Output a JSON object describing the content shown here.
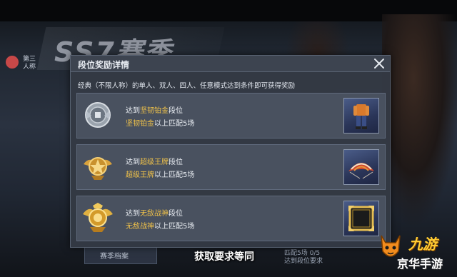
{
  "background": {
    "season_banner": "SS7赛季",
    "left_mode_label": "第三人称"
  },
  "dialog": {
    "title": "段位奖励详情",
    "close_icon": "close-icon",
    "description": "经典（不限人称）的单人、双人、四人、任意模式达到条件即可获得奖励",
    "rows": [
      {
        "line1_prefix": "达到",
        "tier": "坚韧铂金",
        "line1_suffix": "段位",
        "line2_tier": "坚韧铂金",
        "line2_suffix": "以上匹配5场",
        "emblem_icon": "platinum-emblem-icon",
        "reward_icon": "outfit-reward-icon",
        "tier_color": "#f0c24a"
      },
      {
        "line1_prefix": "达到",
        "tier": "超级王牌",
        "line1_suffix": "段位",
        "line2_tier": "超级王牌",
        "line2_suffix": "以上匹配5场",
        "emblem_icon": "ace-emblem-icon",
        "reward_icon": "parachute-reward-icon",
        "tier_color": "#f0c24a"
      },
      {
        "line1_prefix": "达到",
        "tier": "无敌战神",
        "line1_suffix": "段位",
        "line2_tier": "无敌战神",
        "line2_suffix": "以上匹配5场",
        "emblem_icon": "conqueror-emblem-icon",
        "reward_icon": "avatar-frame-reward-icon",
        "tier_color": "#f0c24a"
      }
    ]
  },
  "caption": "获取要求等同",
  "bottom": {
    "left_button": "赛季档案",
    "right_text_1": "匹配5场 0/5",
    "right_text_2": "达到段位要求"
  },
  "watermark": {
    "top": "九游",
    "bottom": "京华手游"
  }
}
